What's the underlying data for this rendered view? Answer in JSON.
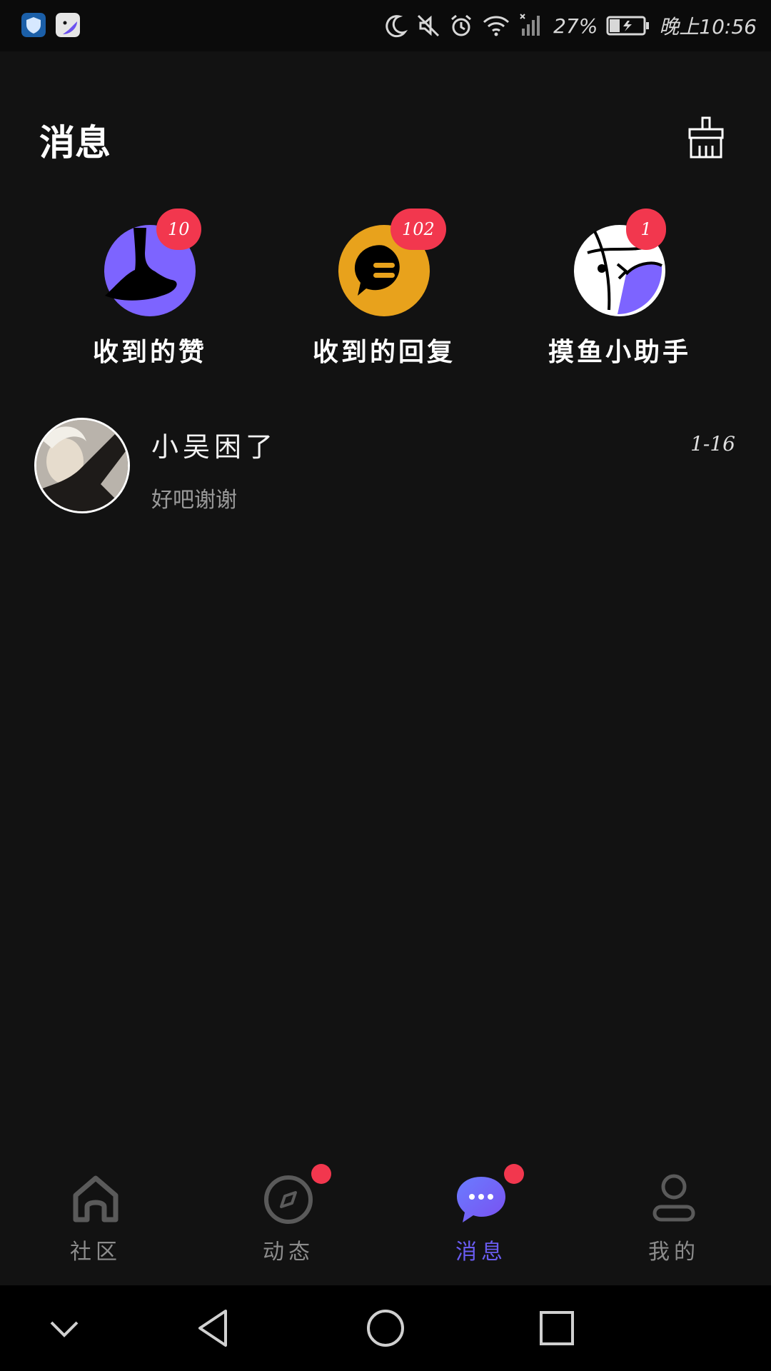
{
  "status_bar": {
    "battery": "27%",
    "time": "晚上10:56",
    "icons": [
      "shield-app-icon",
      "fish-app-icon",
      "moon-icon",
      "mute-icon",
      "alarm-icon",
      "wifi-icon",
      "signal-icon",
      "battery-icon"
    ]
  },
  "header": {
    "title": "消息",
    "clear_icon": "broom-icon"
  },
  "shortcuts": [
    {
      "label": "收到的赞",
      "badge": "10",
      "icon": "thumbs-up-icon",
      "color": "#7d64ff"
    },
    {
      "label": "收到的回复",
      "badge": "102",
      "icon": "chat-bubble-icon",
      "color": "#e8a21c"
    },
    {
      "label": "摸鱼小助手",
      "badge": "1",
      "icon": "fish-assistant-icon",
      "color": "#7d64ff"
    }
  ],
  "conversations": [
    {
      "name": "小吴困了",
      "last_message": "好吧谢谢",
      "time": "1-16"
    }
  ],
  "tabs": [
    {
      "label": "社区",
      "icon": "home-icon",
      "dot": false,
      "active": false
    },
    {
      "label": "动态",
      "icon": "compass-icon",
      "dot": true,
      "active": false
    },
    {
      "label": "消息",
      "icon": "message-icon",
      "dot": true,
      "active": true
    },
    {
      "label": "我的",
      "icon": "profile-icon",
      "dot": false,
      "active": false
    }
  ],
  "colors": {
    "background": "#121212",
    "accent": "#6a5cf2",
    "badge": "#f2374e",
    "reply_icon": "#e8a21c",
    "like_icon": "#7d64ff"
  }
}
